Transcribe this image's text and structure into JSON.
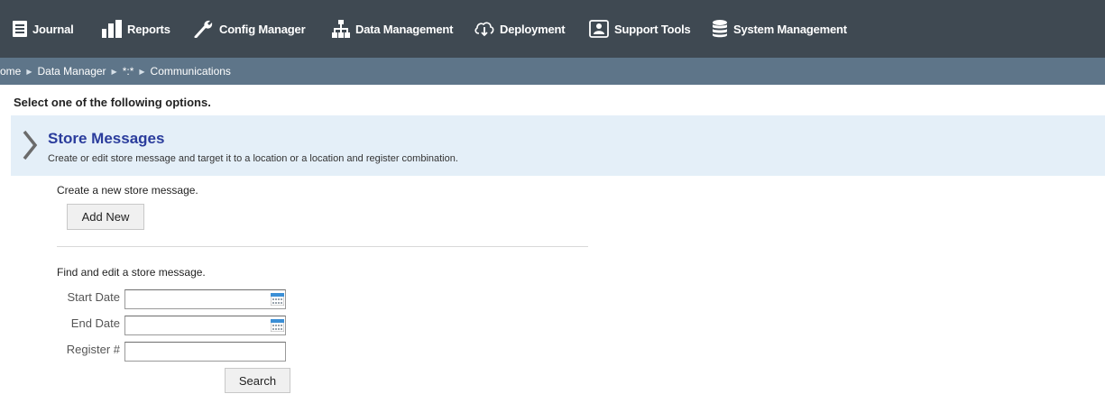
{
  "nav": {
    "items": [
      {
        "label": "Journal",
        "icon": "journal-icon"
      },
      {
        "label": "Reports",
        "icon": "bar-chart-icon"
      },
      {
        "label": "Config Manager",
        "icon": "wrench-icon"
      },
      {
        "label": "Data Management",
        "icon": "hierarchy-icon"
      },
      {
        "label": "Deployment",
        "icon": "cloud-download-icon"
      },
      {
        "label": "Support Tools",
        "icon": "support-person-icon"
      },
      {
        "label": "System Management",
        "icon": "database-icon"
      }
    ]
  },
  "breadcrumb": {
    "items": [
      "ome",
      "Data Manager",
      "*:*",
      "Communications"
    ],
    "separator": "▶"
  },
  "instruction": "Select one of the following options.",
  "section": {
    "title": "Store Messages",
    "description": "Create or edit store message and target it to a location or a location and register combination."
  },
  "create": {
    "label": "Create a new store message.",
    "button": "Add New"
  },
  "find": {
    "label": "Find and edit a store message.",
    "start_date_label": "Start Date",
    "end_date_label": "End Date",
    "register_label": "Register #",
    "start_date_value": "",
    "end_date_value": "",
    "register_value": "",
    "search_button": "Search"
  },
  "colors": {
    "nav_bg": "#3f4952",
    "breadcrumb_bg": "#5e7589",
    "section_bg": "#e4eff8",
    "section_title": "#2a3c9c"
  }
}
